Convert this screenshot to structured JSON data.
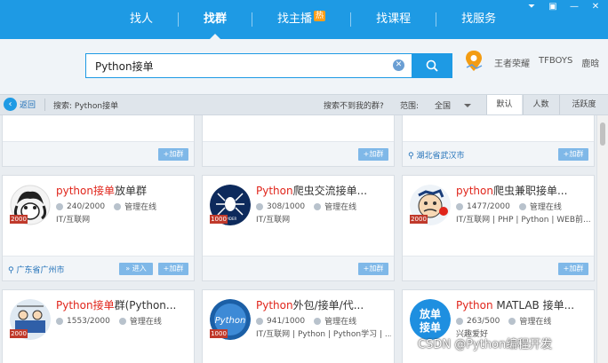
{
  "window_controls": [
    "⏷",
    "▣",
    "—",
    "✕"
  ],
  "nav": {
    "items": [
      {
        "label": "找人",
        "active": false
      },
      {
        "label": "找群",
        "active": true
      },
      {
        "label": "找主播",
        "active": false,
        "badge": "热"
      },
      {
        "label": "找课程",
        "active": false
      },
      {
        "label": "找服务",
        "active": false
      }
    ]
  },
  "search": {
    "value": "Python接单",
    "clear_icon": "✕"
  },
  "quick_links": [
    "王者荣耀",
    "TFBOYS",
    "鹿晗"
  ],
  "filter": {
    "back_label": "返回",
    "crumb": "搜索: Python接单",
    "not_found": "搜索不到我的群?",
    "range_label": "范围:",
    "range_value": "全国",
    "sort_tabs": [
      "默认",
      "人数",
      "活跃度"
    ],
    "active_sort": "默认"
  },
  "join_label": "+加群",
  "enter_label": "» 进入",
  "top_row": {
    "loc3": "湖北省武汉市"
  },
  "cards_row2": [
    {
      "title_hi": "python接单",
      "title_rest": "放单群",
      "members": "240/2000",
      "admin": "管理在线",
      "tags": "IT/互联网",
      "badge": "2000",
      "location": "广东省广州市"
    },
    {
      "title_hi": "Python",
      "title_rest": "爬虫交流接单...",
      "members": "308/1000",
      "admin": "管理在线",
      "tags": "IT/互联网",
      "badge": "1000"
    },
    {
      "title_hi": "python",
      "title_rest": "爬虫兼职接单...",
      "members": "1477/2000",
      "admin": "管理在线",
      "tags": "IT/互联网 | PHP | Python | WEB前...",
      "badge": "2000"
    }
  ],
  "cards_row3": [
    {
      "title_hi": "Python接单",
      "title_rest": "群(Python...",
      "members": "1553/2000",
      "admin": "管理在线",
      "badge": "2000"
    },
    {
      "title_hi": "Python",
      "title_rest": "外包/接单/代...",
      "members": "941/1000",
      "admin": "管理在线",
      "tags": "IT/互联网 | Python | Python学习 | ...",
      "badge": "1000"
    },
    {
      "title_hi": "Python",
      "title_rest": " MATLAB 接单...",
      "members": "263/500",
      "admin": "管理在线",
      "tags": "兴趣爱好"
    }
  ],
  "watermark": "CSDN @Python编程开发",
  "colors": {
    "brand": "#1e9ae4",
    "highlight": "#e0251b"
  }
}
